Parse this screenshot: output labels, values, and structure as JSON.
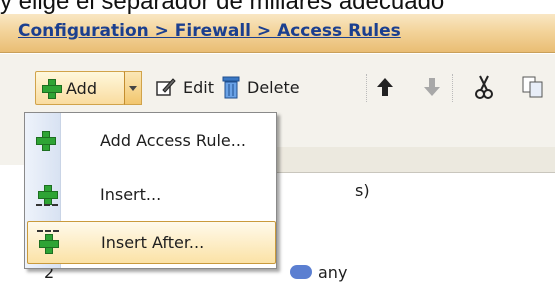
{
  "caption": "y elige el separador de millares adecuado",
  "breadcrumb": "Configuration > Firewall > Access Rules",
  "toolbar": {
    "add_label": "Add",
    "edit_label": "Edit",
    "delete_label": "Delete"
  },
  "menu": {
    "items": [
      {
        "label": "Add Access Rule..."
      },
      {
        "label": "Insert..."
      },
      {
        "label": "Insert After..."
      }
    ]
  },
  "table": {
    "cell_fragment": "s)",
    "row_number": "2",
    "source_value": "any"
  },
  "colors": {
    "breadcrumb_link": "#1b3f8f",
    "highlight": "#fbe2a6",
    "plus_green": "#2ea435"
  }
}
